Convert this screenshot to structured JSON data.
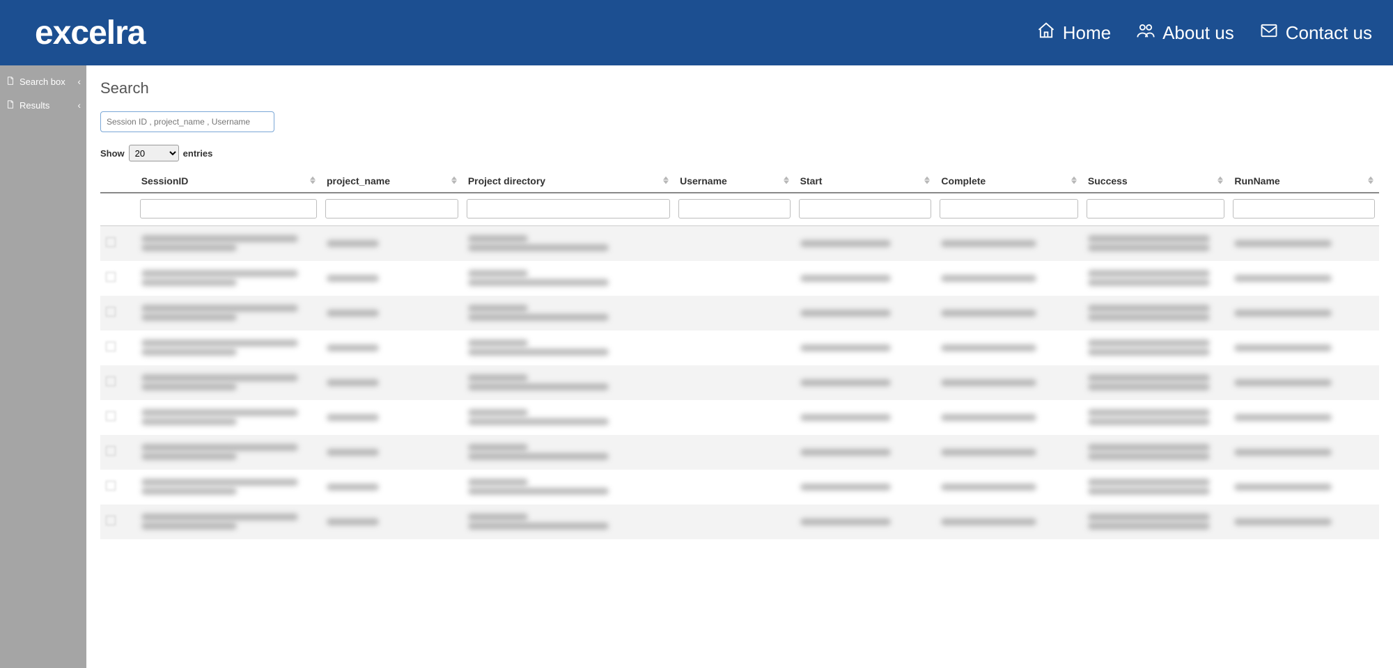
{
  "brand": "excelra",
  "nav": {
    "home": "Home",
    "about": "About us",
    "contact": "Contact us"
  },
  "sidebar": {
    "items": [
      {
        "label": "Search box"
      },
      {
        "label": "Results"
      }
    ]
  },
  "page": {
    "title": "Search",
    "search_placeholder": "Session ID , project_name , Username",
    "show_prefix": "Show",
    "show_suffix": "entries",
    "show_value": "20"
  },
  "table": {
    "columns": [
      "SessionID",
      "project_name",
      "Project directory",
      "Username",
      "Start",
      "Complete",
      "Success",
      "RunName"
    ],
    "row_count": 9
  }
}
